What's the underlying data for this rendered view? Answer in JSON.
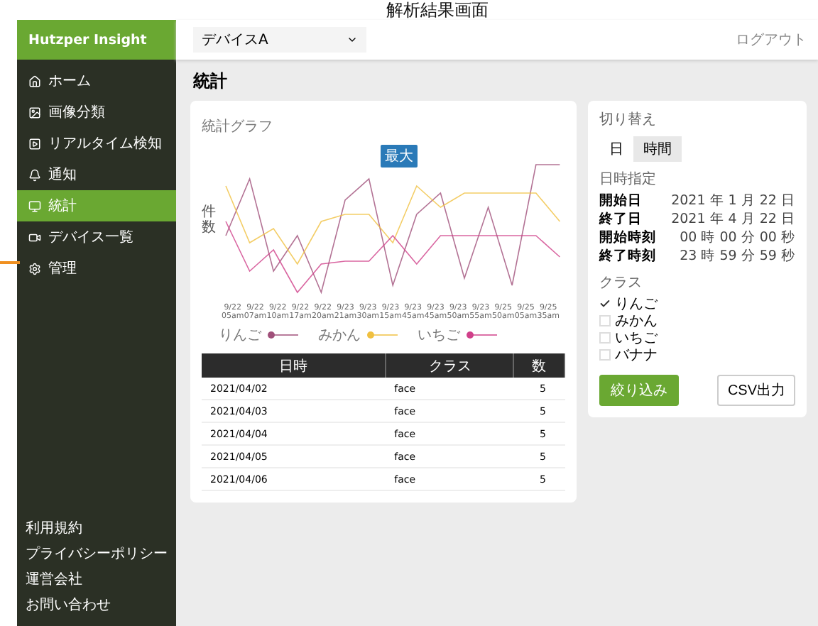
{
  "caption": "解析結果画面",
  "app": {
    "brand": "Hutzper Insight",
    "device_select": "デバイスA",
    "logout": "ログアウト"
  },
  "sidebar": {
    "items": [
      {
        "label": "ホーム",
        "selected": false
      },
      {
        "label": "画像分類",
        "selected": false
      },
      {
        "label": "リアルタイム検知",
        "selected": false
      },
      {
        "label": "通知",
        "selected": false
      },
      {
        "label": "統計",
        "selected": true
      },
      {
        "label": "デバイス一覧",
        "selected": false
      },
      {
        "label": "管理",
        "selected": false
      }
    ],
    "footer": [
      "利用規約",
      "プライバシーポリシー",
      "運営会社",
      "お問い合わせ"
    ]
  },
  "page_title": "統計",
  "chart": {
    "title": "統計グラフ",
    "ylabel": "件数",
    "tooltip": "最大",
    "x_labels": [
      [
        "9/22",
        "05am"
      ],
      [
        "9/22",
        "07am"
      ],
      [
        "9/22",
        "10am"
      ],
      [
        "9/22",
        "17am"
      ],
      [
        "9/22",
        "20am"
      ],
      [
        "9/23",
        "21am"
      ],
      [
        "9/23",
        "30am"
      ],
      [
        "9/23",
        "15am"
      ],
      [
        "9/23",
        "45am"
      ],
      [
        "9/23",
        "45am"
      ],
      [
        "9/23",
        "50am"
      ],
      [
        "9/23",
        "55am"
      ],
      [
        "9/25",
        "50am"
      ],
      [
        "9/25",
        "05am"
      ],
      [
        "9/25",
        "35am"
      ]
    ],
    "legend": [
      {
        "label": "りんご",
        "color": "#a0507a"
      },
      {
        "label": "みかん",
        "color": "#f0c040"
      },
      {
        "label": "いちご",
        "color": "#d0408a"
      }
    ]
  },
  "table": {
    "columns": [
      "日時",
      "クラス",
      "数"
    ],
    "rows": [
      [
        "2021/04/02",
        "face",
        "5"
      ],
      [
        "2021/04/03",
        "face",
        "5"
      ],
      [
        "2021/04/04",
        "face",
        "5"
      ],
      [
        "2021/04/05",
        "face",
        "5"
      ],
      [
        "2021/04/06",
        "face",
        "5"
      ]
    ]
  },
  "filter": {
    "switch_label": "切り替え",
    "units": [
      {
        "label": "日",
        "selected": false
      },
      {
        "label": "時間",
        "selected": true
      }
    ],
    "range_label": "日時指定",
    "fields": [
      {
        "label": "開始日",
        "value": "2021 年 1 月 22 日"
      },
      {
        "label": "終了日",
        "value": "2021 年 4 月 22 日"
      },
      {
        "label": "開始時刻",
        "value": "00 時 00 分 00 秒"
      },
      {
        "label": "終了時刻",
        "value": "23 時 59 分 59 秒"
      }
    ],
    "class_label": "クラス",
    "classes": [
      {
        "label": "りんご",
        "checked": true
      },
      {
        "label": "みかん",
        "checked": false
      },
      {
        "label": "いちご",
        "checked": false
      },
      {
        "label": "バナナ",
        "checked": false
      }
    ],
    "apply": "絞り込み",
    "export": "CSV出力"
  }
}
